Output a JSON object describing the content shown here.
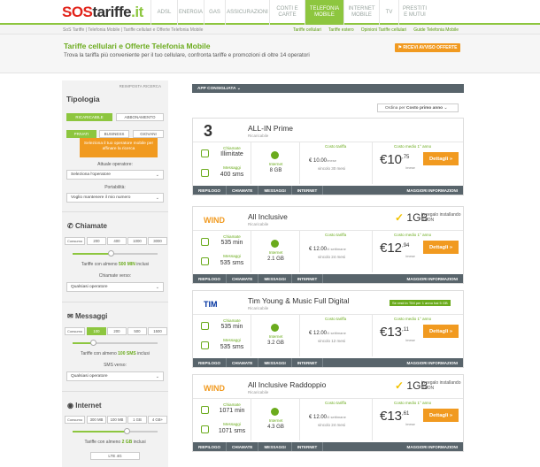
{
  "logo": {
    "p1": "SOS",
    "p2": "tariffe",
    "p3": ".it"
  },
  "nav": [
    {
      "label": "ADSL",
      "active": false
    },
    {
      "label": "ENERGIA",
      "active": false
    },
    {
      "label": "GAS",
      "active": false
    },
    {
      "label": "ASSICURAZIONI",
      "active": false
    },
    {
      "label": "CONTI E CARTE",
      "active": false
    },
    {
      "label": "TELEFONIA MOBILE",
      "active": true
    },
    {
      "label": "INTERNET MOBILE",
      "active": false
    },
    {
      "label": "TV",
      "active": false
    },
    {
      "label": "PRESTITI E MUTUI",
      "active": false
    }
  ],
  "breadcrumb": {
    "path": "SoS Tariffe  |  Telefonia Mobile  |  Tariffe cellulari e Offerte Telefonia Mobile",
    "links": [
      "Tariffe cellulari",
      "Tariffe estero",
      "Opinioni Tariffe cellulari",
      "Guide Telefonia Mobile"
    ]
  },
  "hero": {
    "title": "Tariffe cellulari e Offerte Telefonia Mobile",
    "subtitle": "Trova la tariffa più conveniente per il tuo cellulare, confronta tariffe e promozioni di oltre 14 operatori",
    "avviso": "RICEVI AVVISO OFFERTE"
  },
  "sidebar": {
    "reset": "REIMPOSTA RICERCA",
    "tipologia": "Tipologia",
    "ricaricabile": "RICARICABILE",
    "abbonamento": "ABBONAMENTO",
    "privati": "PRIVATI",
    "business": "BUSINESS",
    "giovani": "GIOVANI",
    "tip": "Seleziona il tuo operatore mobile per affinare la ricerca",
    "operatore_label": "Attuale operatore:",
    "operatore_value": "Seleziona l'operatore",
    "portabilita_label": "Portabilità:",
    "portabilita_value": "Voglio mantenere il mio numero",
    "chiamate": "Chiamate",
    "consumo": "Consumo",
    "chiamate_steps": [
      "200",
      "400",
      "1000",
      "3000"
    ],
    "chiamate_pre": "Tariffe con almeno ",
    "chiamate_min": "500 MIN",
    "chiamate_post": " inclusi",
    "chiamate_verso": "Chiamate verso:",
    "qualsiasi": "Qualsiasi operatore",
    "messaggi": "Messaggi",
    "messaggi_steps": [
      "100",
      "200",
      "500",
      "1500"
    ],
    "messaggi_pre": "Tariffe con almeno ",
    "messaggi_sms": "100 SMS",
    "messaggi_post": " inclusi",
    "sms_verso": "SMS verso:",
    "internet": "Internet",
    "internet_steps": [
      "300 MB",
      "100 MB",
      "1 GB",
      "4 GB+"
    ],
    "internet_pre": "Tariffe con almeno ",
    "internet_gb": "2 GB",
    "internet_post": " inclusi",
    "lte": "LTE 4G"
  },
  "main": {
    "consigliata": "APP CONSIGLIATA",
    "ordina": "Ordina per",
    "ordina_val": "Costo primo anno"
  },
  "cards": [
    {
      "brand": "3",
      "brand_color": "#333",
      "name": "ALL-IN Prime",
      "type": "Ricaricabile",
      "chiamate_label": "Chiamate",
      "chiamate": "Illimitate",
      "messaggi_label": "Messaggi",
      "messaggi": "400 sms",
      "internet_label": "Internet",
      "internet": "8 GB",
      "costo_label": "Costo tariffa",
      "costo": "€ 10.00",
      "costo_unit": "/mese",
      "vincolo": "vincolo 30 mesi",
      "medio_label": "Costo medio 1° anno",
      "euro": "€10",
      "cent": ",75",
      "medio_unit": "/mese",
      "dettagli": "Dettagli »",
      "extra": "",
      "promo": "",
      "footer": [
        "RIEPILOGO",
        "CHIAMATE",
        "MESSAGGI",
        "INTERNET",
        "MAGGIORI INFORMAZIONI"
      ]
    },
    {
      "brand": "WIND",
      "brand_color": "#f19a20",
      "name": "All Inclusive",
      "type": "Ricaricabile",
      "chiamate_label": "Chiamate",
      "chiamate": "535 min",
      "messaggi_label": "Messaggi",
      "messaggi": "535 sms",
      "internet_label": "Internet",
      "internet": "2.1 GB",
      "costo_label": "Costo tariffa",
      "costo": "€ 12.00",
      "costo_unit": "/4 settimane",
      "vincolo": "vincolo 24 mesi",
      "medio_label": "Costo medio 1° anno",
      "euro": "€12",
      "cent": ",94",
      "medio_unit": "/mese",
      "dettagli": "Dettagli »",
      "extra": "1GB",
      "extra_note": "in regalo installando VEON",
      "promo": "",
      "footer": [
        "RIEPILOGO",
        "CHIAMATE",
        "MESSAGGI",
        "INTERNET",
        "MAGGIORI INFORMAZIONI"
      ]
    },
    {
      "brand": "TIM",
      "brand_color": "#0033a0",
      "name": "Tim Young & Music Full Digital",
      "type": "Ricaricabile",
      "chiamate_label": "Chiamate",
      "chiamate": "535 min",
      "messaggi_label": "Messaggi",
      "messaggi": "535 sms",
      "internet_label": "Internet",
      "internet": "3.2 GB",
      "costo_label": "Costo tariffa",
      "costo": "€ 12.00",
      "costo_unit": "/4 settimane",
      "vincolo": "vincolo 12 mesi",
      "medio_label": "Costo medio 1° anno",
      "euro": "€13",
      "cent": ",11",
      "medio_unit": "/mese",
      "dettagli": "Dettagli »",
      "extra": "",
      "promo": "Se resti in TIM per 1 anno hai 5 GB",
      "footer": [
        "RIEPILOGO",
        "CHIAMATE",
        "MESSAGGI",
        "INTERNET",
        "MAGGIORI INFORMAZIONI"
      ]
    },
    {
      "brand": "WIND",
      "brand_color": "#f19a20",
      "name": "All Inclusive Raddoppio",
      "type": "Ricaricabile",
      "chiamate_label": "Chiamate",
      "chiamate": "1071 min",
      "messaggi_label": "Messaggi",
      "messaggi": "1071 sms",
      "internet_label": "Internet",
      "internet": "4.3 GB",
      "costo_label": "Costo tariffa",
      "costo": "€ 12.00",
      "costo_unit": "/4 settimane",
      "vincolo": "vincolo 24 mesi",
      "medio_label": "Costo medio 1° anno",
      "euro": "€13",
      "cent": ",61",
      "medio_unit": "/mese",
      "dettagli": "Dettagli »",
      "extra": "1GB",
      "extra_note": "in regalo installando VEON",
      "promo": "",
      "footer": [
        "RIEPILOGO",
        "CHIAMATE",
        "MESSAGGI",
        "INTERNET",
        "MAGGIORI INFORMAZIONI"
      ]
    }
  ]
}
